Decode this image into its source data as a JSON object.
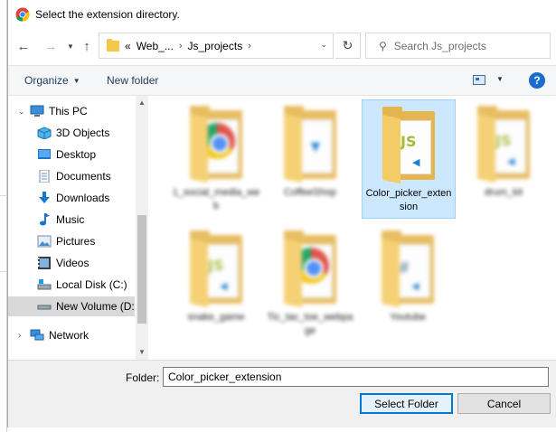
{
  "window": {
    "title": "Select the extension directory."
  },
  "address_bar": {
    "crumbs": [
      "Web_...",
      "Js_projects"
    ],
    "overflow": "«",
    "separator": "›"
  },
  "search": {
    "placeholder": "Search Js_projects"
  },
  "command_bar": {
    "organize": "Organize",
    "new_folder": "New folder",
    "help": "?"
  },
  "nav_tree": [
    {
      "label": "This PC",
      "icon": "computer-icon"
    },
    {
      "label": "3D Objects",
      "icon": "cube-icon"
    },
    {
      "label": "Desktop",
      "icon": "desktop-icon"
    },
    {
      "label": "Documents",
      "icon": "documents-icon"
    },
    {
      "label": "Downloads",
      "icon": "download-icon"
    },
    {
      "label": "Music",
      "icon": "music-icon"
    },
    {
      "label": "Pictures",
      "icon": "pictures-icon"
    },
    {
      "label": "Videos",
      "icon": "videos-icon"
    },
    {
      "label": "Local Disk (C:)",
      "icon": "drive-icon"
    },
    {
      "label": "New Volume (D:",
      "icon": "drive-icon",
      "selected": true
    },
    {
      "label": "Network",
      "icon": "network-icon"
    }
  ],
  "folders": [
    {
      "label": "1_social_media_web",
      "art": "chrome",
      "blurred": true
    },
    {
      "label": "CoffeeShop",
      "art": "vscode",
      "blurred": true
    },
    {
      "label": "Color_picker_extension",
      "art": "js",
      "blurred": false,
      "selected": true
    },
    {
      "label": "drum_kit",
      "art": "js",
      "blurred": true
    },
    {
      "label": "snake_game",
      "art": "js",
      "blurred": true
    },
    {
      "label": "Tic_tac_toe_webpage",
      "art": "chrome",
      "blurred": true
    },
    {
      "label": "Youtube",
      "art": "hash",
      "blurred": true
    }
  ],
  "footer": {
    "folder_label": "Folder:",
    "folder_value": "Color_picker_extension",
    "select_button": "Select Folder",
    "cancel_button": "Cancel"
  },
  "colors": {
    "selection": "#cce8ff",
    "accent": "#0078d7",
    "folder": "#e5b64f"
  }
}
